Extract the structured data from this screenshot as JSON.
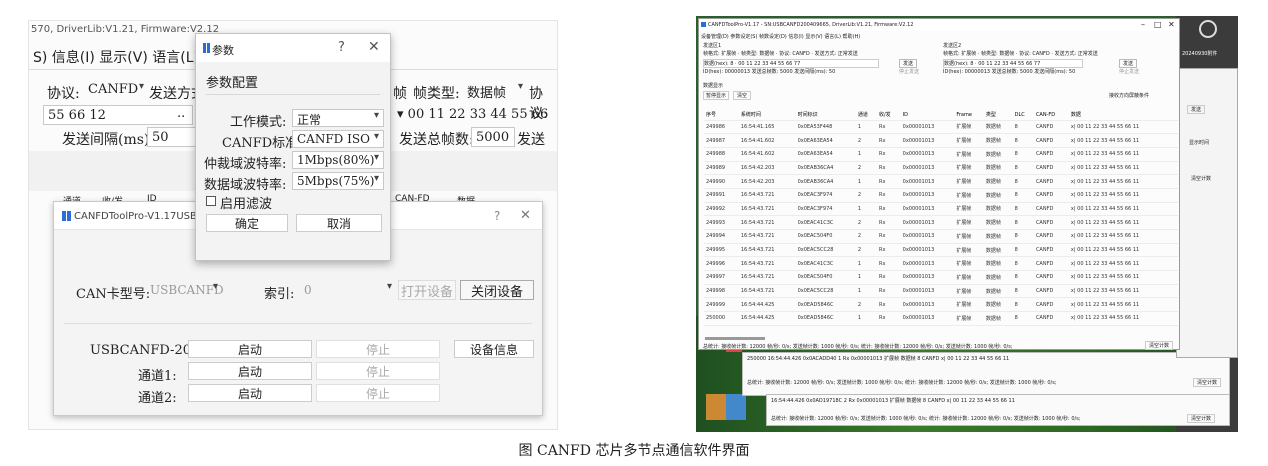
{
  "left_window": {
    "title": "570, DriverLib:V1.21, Firmware:V2.12",
    "menu": "S) 信息(I) 显示(V) 语言(L)",
    "row1_protocol_label": "协议:",
    "row1_protocol_value": "CANFD",
    "row1_send_mode": "发送方式",
    "row1_frame_hint": "帧",
    "row1_frame_type_label": "帧类型:",
    "row1_frame_type_value": "数据帧",
    "row1_protocol2_label": "协议:",
    "data_left": "55 66 12",
    "data_left_dots": "..",
    "data_right": "00 11 22 33 44 55 66",
    "interval_label": "发送间隔(ms):",
    "interval_value": "50",
    "total_frames_label": "发送总帧数:",
    "total_frames_value": "5000",
    "send_label": "发送间",
    "columns": [
      "通道",
      "收/发",
      "ID",
      "CAN-FD",
      "数据"
    ]
  },
  "param_dialog": {
    "title": "参数",
    "help": "?",
    "close": "✕",
    "section": "参数配置",
    "work_mode_label": "工作模式:",
    "work_mode_value": "正常",
    "canfd_std_label": "CANFD标准:",
    "canfd_std_value": "CANFD ISO",
    "arb_rate_label": "仲裁域波特率:",
    "arb_rate_value": "1Mbps(80%)",
    "data_rate_label": "数据域波特率:",
    "data_rate_value": "5Mbps(75%)",
    "filter_label": "启用滤波",
    "ok": "确定",
    "cancel": "取消"
  },
  "device_dialog": {
    "title": "CANFDToolPro-V1.17USBCANFD",
    "help": "?",
    "close": "✕",
    "card_label": "CAN卡型号:",
    "card_value": "USBCANFD",
    "index_label": "索引:",
    "index_value": "0",
    "open": "打开设备",
    "close_device": "关闭设备",
    "device_label": "USBCANFD-200U:",
    "start": "启动",
    "stop": "停止",
    "info": "设备信息",
    "ch1_label": "通道1:",
    "ch2_label": "通道2:"
  },
  "right_window": {
    "title": "CANFDToolPro-V1.17 - SN:USBCANFD200409665, DriverLib:V1.21, Firmware:V2.12",
    "menu": "设备管理(D) 参数设定(S) 帧数设定(D) 信息(I) 显示(V) 语言(L) 帮助(H)",
    "send_box_label": "发送区1",
    "send_box_label2": "发送区2",
    "ctrl_line": "帧格式: 扩展帧 · 帧类型: 数据帧 · 协议: CANFD · 发送方式: 正常发送",
    "data_line": "数据(hex): 8 · 00 11 22 33 44 55 66 77",
    "id_line": "ID(hex): 00000013   发送总帧数: 5000   发送间隔(ms): 50",
    "send_btn": "发送",
    "stop_btn": "停止发送",
    "recv_label": "数据显示",
    "show_tab": "暂停显示",
    "clear_btn": "清空",
    "filter_hint": "接收方向屏蔽条件",
    "columns": [
      "序号",
      "系统时间",
      "时间标识",
      "通道",
      "收/发",
      "ID",
      "Frame",
      "类型",
      "DLC",
      "CAN-FD",
      "数据"
    ],
    "rows": [
      [
        "249986",
        "16:54:41.165",
        "0x0EA53F448",
        "1",
        "Rx",
        "0x00001013",
        "扩展帧",
        "数据帧",
        "8",
        "CANFD",
        "x| 00 11 22 33 44 55 66 11"
      ],
      [
        "249987",
        "16:54:41.602",
        "0x0EA63EA54",
        "2",
        "Rx",
        "0x00001013",
        "扩展帧",
        "数据帧",
        "8",
        "CANFD",
        "x| 00 11 22 33 44 55 66 11"
      ],
      [
        "249988",
        "16:54:41.602",
        "0x0EA63EA54",
        "1",
        "Rx",
        "0x00001013",
        "扩展帧",
        "数据帧",
        "8",
        "CANFD",
        "x| 00 11 22 33 44 55 66 11"
      ],
      [
        "249989",
        "16:54:42.203",
        "0x0EAB36CA4",
        "2",
        "Rx",
        "0x00001013",
        "扩展帧",
        "数据帧",
        "8",
        "CANFD",
        "x| 00 11 22 33 44 55 66 11"
      ],
      [
        "249990",
        "16:54:42.203",
        "0x0EAB36CA4",
        "1",
        "Rx",
        "0x00001013",
        "扩展帧",
        "数据帧",
        "8",
        "CANFD",
        "x| 00 11 22 33 44 55 66 11"
      ],
      [
        "249991",
        "16:54:43.721",
        "0x0EAC3F974",
        "2",
        "Rx",
        "0x00001013",
        "扩展帧",
        "数据帧",
        "8",
        "CANFD",
        "x| 00 11 22 33 44 55 66 11"
      ],
      [
        "249992",
        "16:54:43.721",
        "0x0EAC3F974",
        "1",
        "Rx",
        "0x00001013",
        "扩展帧",
        "数据帧",
        "8",
        "CANFD",
        "x| 00 11 22 33 44 55 66 11"
      ],
      [
        "249993",
        "16:54:43.721",
        "0x0EAC41C3C",
        "2",
        "Rx",
        "0x00001013",
        "扩展帧",
        "数据帧",
        "8",
        "CANFD",
        "x| 00 11 22 33 44 55 66 11"
      ],
      [
        "249994",
        "16:54:43.721",
        "0x0EAC504F0",
        "2",
        "Rx",
        "0x00001013",
        "扩展帧",
        "数据帧",
        "8",
        "CANFD",
        "x| 00 11 22 33 44 55 66 11"
      ],
      [
        "249995",
        "16:54:43.721",
        "0x0EAC5CC28",
        "2",
        "Rx",
        "0x00001013",
        "扩展帧",
        "数据帧",
        "8",
        "CANFD",
        "x| 00 11 22 33 44 55 66 11"
      ],
      [
        "249996",
        "16:54:43.721",
        "0x0EAC41C3C",
        "1",
        "Rx",
        "0x00001013",
        "扩展帧",
        "数据帧",
        "8",
        "CANFD",
        "x| 00 11 22 33 44 55 66 11"
      ],
      [
        "249997",
        "16:54:43.721",
        "0x0EAC504F0",
        "1",
        "Rx",
        "0x00001013",
        "扩展帧",
        "数据帧",
        "8",
        "CANFD",
        "x| 00 11 22 33 44 55 66 11"
      ],
      [
        "249998",
        "16:54:43.721",
        "0x0EAC5CC28",
        "1",
        "Rx",
        "0x00001013",
        "扩展帧",
        "数据帧",
        "8",
        "CANFD",
        "x| 00 11 22 33 44 55 66 11"
      ],
      [
        "249999",
        "16:54:44.425",
        "0x0EAD5846C",
        "2",
        "Rx",
        "0x00001013",
        "扩展帧",
        "数据帧",
        "8",
        "CANFD",
        "x| 00 11 22 33 44 55 66 11"
      ],
      [
        "250000",
        "16:54:44.425",
        "0x0EAD5846C",
        "1",
        "Rx",
        "0x00001013",
        "扩展帧",
        "数据帧",
        "8",
        "CANFD",
        "x| 00 11 22 33 44 55 66 11"
      ]
    ],
    "status": "总统计: 接收帧计数: 12000 帧/秒: 0/s; 发送帧计数: 1000 帧/秒: 0/s;   统计: 接收帧计数: 12000 帧/秒: 0/s; 发送帧计数: 1000 帧/秒: 0/s;",
    "clear_stats": "清空计数",
    "ghost_row1": "250000  16:54:44.426  0x0ACADD40  1  Rx  0x00001013  扩展帧  数据帧  8  CANFD  x| 00 11 22 33 44 55 66 11",
    "ghost_row2": "16:54:44.426  0x0AD19718C  2  Rx  0x00001013  扩展帧  数据帧  8  CANFD  x| 00 11 22 33 44 55 66 11",
    "ghost_status1": "总统计: 接收帧计数: 12000 帧/秒: 0/s; 发送帧计数: 1000 帧/秒: 0/s;  统计: 接收帧计数: 12000 帧/秒: 0/s; 发送帧计数: 1000 帧/秒: 0/s;",
    "ghost_status2": "总统计: 接收帧计数: 12000 帧/秒: 0/s; 发送帧计数: 1000 帧/秒: 0/s;  统计: 接收帧计数: 12000 帧/秒: 0/s; 发送帧计数: 1000 帧/秒: 0/s;",
    "side_label1": "发送",
    "side_label2": "显示时间",
    "side_label3": "清空计数",
    "desktop_label": "20240930附件"
  },
  "caption": "图 CANFD 芯片多节点通信软件界面"
}
